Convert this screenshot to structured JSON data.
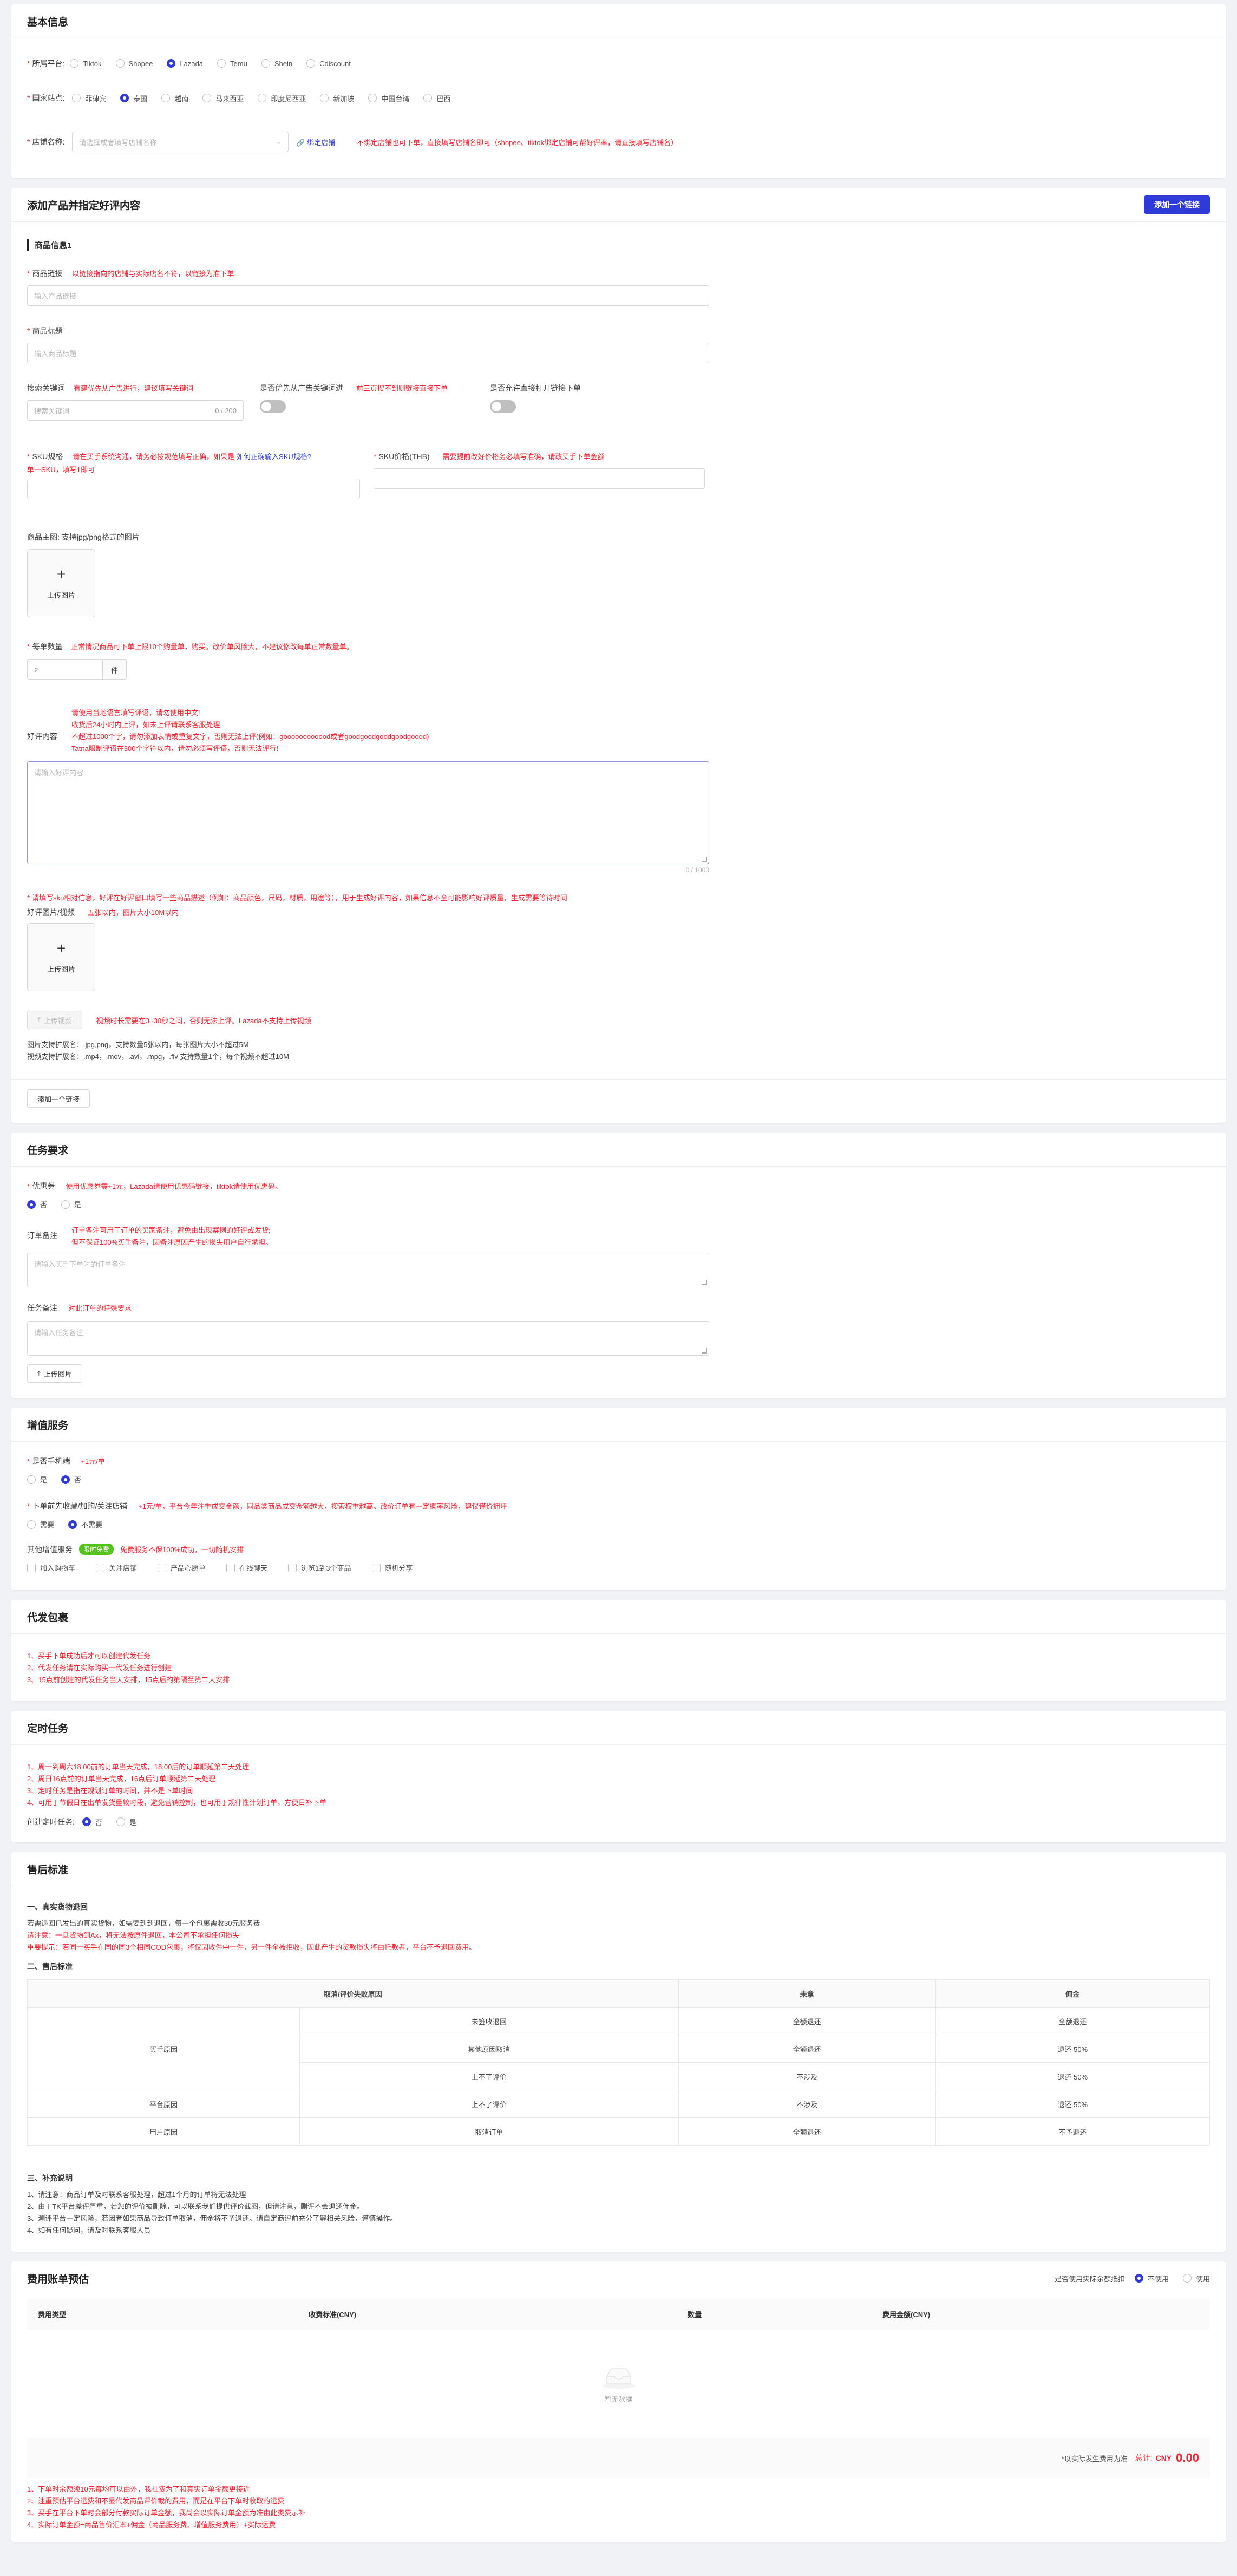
{
  "basic": {
    "title": "基本信息",
    "platform_label": "所属平台:",
    "platforms": [
      "Tiktok",
      "Shopee",
      "Lazada",
      "Temu",
      "Shein",
      "Cdiscount"
    ],
    "platform_selected": "Lazada",
    "country_label": "国家站点:",
    "countries": [
      "菲律宾",
      "泰国",
      "越南",
      "马来西亚",
      "印度尼西亚",
      "新加坡",
      "中国台湾",
      "巴西"
    ],
    "country_selected": "泰国",
    "shop_label": "店铺名称:",
    "shop_placeholder": "请选择或者填写店铺名称",
    "bind_shop_link": "绑定店铺",
    "shop_hint": "不绑定店铺也可下单，直接填写店铺名即可（shopee、tiktok绑定店铺可帮好评率，请直接填写店铺名）"
  },
  "product": {
    "title": "添加产品并指定好评内容",
    "add_link_button": "添加一个链接",
    "item_header": "商品信息1",
    "link_label": "商品链接",
    "link_hint": "以链接指向的店铺与实际店名不符，以链接为准下单",
    "link_placeholder": "输入产品链接",
    "name_label": "商品标题",
    "name_placeholder": "输入商品标题",
    "keyword_label": "搜索关键词",
    "keyword_hint": "有建优先从广告进行，建议填写关键词",
    "keyword_placeholder": "搜索关键词",
    "keyword_count": "0 / 200",
    "ad_label": "是否优先从广告关键词进",
    "ad_hint": "前三页搜不到则链接直接下单",
    "direct_label": "是否允许直接打开链接下单",
    "sku_label": "SKU规格",
    "sku_hint": "请在买手系统沟通，请务必按规范填写正确，如果是",
    "sku_link": "如何正确输入SKU规格?",
    "sku_hint2": "单一SKU，填写1即可",
    "price_label": "SKU价格(THB)",
    "price_hint": "需要提前改好价格务必填写准确，请改买手下单金额",
    "image_label": "商品主图: 支持jpg/png格式的图片",
    "upload_label": "上传图片",
    "qty_label": "每单数量",
    "qty_hint": "正常情况商品可下单上限10个购量单，购买。改价单风险大，不建议修改每单正常数量单。",
    "qty_value": "2",
    "qty_unit": "件",
    "review_label": "好评内容",
    "review_hints": [
      "请使用当地语言填写评语，请勿使用中文!",
      "收货后24小时内上评，如未上评请联系客服处理",
      "不超过1000个字，请勿添加表情或重复文字，否则无法上评(例如：goooooooooood或者goodgoodgoodgoodgoood)",
      "Tatna限制评语在300个字符以内，请勿必须写评语，否则无法评行!"
    ],
    "review_placeholder": "请输入好评内容",
    "review_count": "0 / 1000",
    "photo_hint": "请填写sku相对信息，好评在好评窗口填写一些商品描述（例如：商品颜色，尺码，材质，用途等），用于生成好评内容，如果信息不全可能影响好评质量，生成需要等待时间",
    "photo_label": "好评图片/视频",
    "photo_hint2": "五张以内，图片大小10M以内",
    "video_button": "上传视频",
    "video_hint": "视频时长需要在3~30秒之间，否则无法上评。Lazada不支持上传视频",
    "format_note1": "图片支持扩展名：.jpg,png，支持数量5张以内，每张图片大小不超过5M",
    "format_note2": "视频支持扩展名：.mp4，.mov，.avi，.mpg，.flv 支持数量1个，每个视频不超过10M",
    "add_link_bottom": "添加一个链接"
  },
  "task": {
    "title": "任务要求",
    "coupon_label": "优惠券",
    "coupon_hint": "使用优惠券需+1元，Lazada请使用优惠码链接，tiktok请使用优惠码。",
    "coupon_options": [
      "否",
      "是"
    ],
    "coupon_selected": "否",
    "order_note_label": "订单备注",
    "order_note_hints": [
      "订单备注可用于订单的买家备注，避免由出现案例的好评或发货;",
      "但不保证100%买手备注，因备注原因产生的损失用户自行承担。"
    ],
    "order_note_placeholder": "请输入买手下单时的订单备注",
    "task_note_label": "任务备注",
    "task_note_hint": "对此订单的特殊要求",
    "task_note_placeholder": "请输入任务备注",
    "upload_button": "上传图片"
  },
  "value": {
    "title": "增值服务",
    "phone_label": "是否手机端",
    "phone_hint": "+1元/单",
    "phone_options": [
      "是",
      "否"
    ],
    "phone_selected": "否",
    "stock_label": "下单前先收藏/加购/关注店铺",
    "stock_hint": "+1元/单，平台今年注重成交金额，同品类商品成交金额越大，搜索权重越高。改价订单有一定概率风险，建议谨价拥坪",
    "stock_options": [
      "需要",
      "不需要"
    ],
    "stock_selected": "不需要",
    "other_label": "其他增值服务",
    "free_tag": "限时免费",
    "other_hint": "免费服务不保100%成功，一切随机安排",
    "other_options": [
      "加入购物车",
      "关注店铺",
      "产品心愿单",
      "在线聊天",
      "浏览1到3个商品",
      "随机分享"
    ]
  },
  "package": {
    "title": "代发包裹",
    "lines": [
      "1、买手下单成功后才可以创建代发任务",
      "2、代发任务请在实际购买一代发任务进行创建",
      "3、15点前创建的代发任务当天安排，15点后的第隔至第二天安排"
    ]
  },
  "schedule": {
    "title": "定时任务",
    "lines": [
      "1、周一到周六18:00前的订单当天完成，18:00后的订单顺延第二天处理",
      "2、周日16点前的订单当天完成，16点后订单顺延第二天处理",
      "3、定时任务是指在规划订单的时间，并不是下单时间",
      "4、可用于节假日在出单发货量较时段，避免营销控制，也可用于规律性计划订单，方便日补下单"
    ],
    "create_label": "创建定时任务:",
    "options": [
      "否",
      "是"
    ],
    "selected": "否"
  },
  "aftersale": {
    "title": "售后标准",
    "h1": "一、真实货物退回",
    "p1": "若需退回已发出的真实货物，如需要到到退回，每一个包裹需收30元服务费",
    "p2": "请注意：一旦货物到Ax，将无法按原件退回，本公司不承担任何损失",
    "p3": "重要提示：若同一买手在同的同3个相同COD包裹，将仅因收件中一件，另一件全被拒收，因此产生的货款损失将由托款者，平台不予退回费用。",
    "h2": "二、售后标准",
    "table_headers": [
      "取消/评价失败原因",
      "未拿",
      "佣金"
    ],
    "table_rows": [
      {
        "group": "买手原因",
        "reason": "未签收退回",
        "not": "全额退还",
        "fee": "全额退还"
      },
      {
        "group": "",
        "reason": "其他原因取消",
        "not": "全额退还",
        "fee": "退还 50%"
      },
      {
        "group": "",
        "reason": "上不了评价",
        "not": "不涉及",
        "fee": "退还 50%"
      },
      {
        "group": "平台原因",
        "reason": "上不了评价",
        "not": "不涉及",
        "fee": "退还 50%"
      },
      {
        "group": "用户原因",
        "reason": "取消订单",
        "not": "全额退还",
        "fee": "不予退还"
      }
    ],
    "h3": "三、补充说明",
    "notes": [
      "1、请注意：商品订单及时联系客服处理，超过1个月的订单将无法处理",
      "2、由于TK平台差评严重，若您的评价被删除，可以联系我们提供评价截图，但请注意，删评不会退还佣金。",
      "3、测评平台一定风险，若因者如果商品导致订单取消，佣金将不予退还。请自定商评前充分了解相关风险，谨慎操作。",
      "4、如有任何疑问，请及时联系客服人员"
    ]
  },
  "fee": {
    "title": "费用账单预估",
    "balance_label": "是否使用实际余额抵扣",
    "balance_options": [
      "不使用",
      "使用"
    ],
    "balance_selected": "不使用",
    "headers": [
      "费用类型",
      "收费标准(CNY)",
      "数量",
      "费用金额(CNY)"
    ],
    "empty_text": "暂无数据",
    "total_note": "*以实际发生费用为准",
    "total_label": "总计:",
    "total_currency": "CNY",
    "total_value": "0.00",
    "notes": [
      "1、下单时余额须10元每均可以由外，我社费为了和真实订单金额更接近",
      "2、注重预估平台运费和不显代发商品评价截的费用，而是在平台下单时收取的运费",
      "3、买手在平台下单时会部分付款实际订单金额，我尚会以实际订单金额为准由此类费示补",
      "4、实际订单金额=商品售价汇率+佣金（商品服务费、增值服务费用）+实际运费"
    ]
  }
}
